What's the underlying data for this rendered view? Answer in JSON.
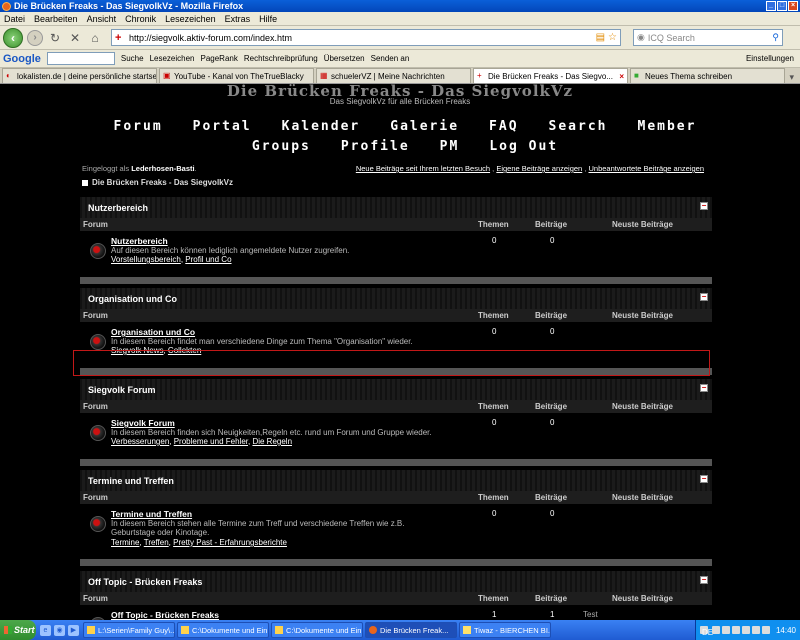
{
  "window": {
    "title": "Die Brücken Freaks - Das SiegvolkVz - Mozilla Firefox"
  },
  "menu": [
    "Datei",
    "Bearbeiten",
    "Ansicht",
    "Chronik",
    "Lesezeichen",
    "Extras",
    "Hilfe"
  ],
  "nav": {
    "url": "http://siegvolk.aktiv-forum.com/index.htm",
    "search_placeholder": "ICQ Search"
  },
  "google_toolbar": {
    "logo": "Google",
    "search_label": "Suche",
    "items": [
      "Lesezeichen",
      "PageRank",
      "Rechtschreibprüfung",
      "Übersetzen",
      "Senden an"
    ],
    "settings": "Einstellungen"
  },
  "tabs": [
    {
      "label": "lokalisten.de | deine persönliche startseite",
      "active": false
    },
    {
      "label": "YouTube - Kanal von TheTrueBlacky",
      "active": false
    },
    {
      "label": "schuelerVZ | Meine Nachrichten",
      "active": false
    },
    {
      "label": "Die Brücken Freaks - Das Siegvo...",
      "active": true
    },
    {
      "label": "Neues Thema schreiben",
      "active": false
    }
  ],
  "site": {
    "title": "Die Brücken Freaks - Das SiegvolkVz",
    "subtitle": "Das SiegvolkVz für alle Brücken Freaks"
  },
  "mainnav": {
    "row1": [
      "Forum",
      "Portal",
      "Kalender",
      "Galerie",
      "FAQ",
      "Search",
      "Member"
    ],
    "row2": [
      "Groups",
      "Profile",
      "PM",
      "Log Out"
    ]
  },
  "login": {
    "prefix": "Eingeloggt als",
    "user": "Lederhosen-Basti",
    "suffix": "."
  },
  "quicklinks": [
    "Neue Beiträge seit Ihrem letzten Besuch",
    "Eigene Beiträge anzeigen",
    "Unbeantwortete Beiträge anzeigen"
  ],
  "breadcrumb": "Die Brücken Freaks - Das SiegvolkVz",
  "columns": {
    "forum": "Forum",
    "themen": "Themen",
    "beitraege": "Beiträge",
    "neuste": "Neuste Beiträge"
  },
  "categories": [
    {
      "name": "Nutzerbereich",
      "forum_title": "Nutzerbereich",
      "desc": "Auf diesen Bereich können lediglich angemeldete Nutzer zugreifen.",
      "subforums": [
        "Vorstellungsbereich",
        "Profil und Co"
      ],
      "themen": "0",
      "beitraege": "0",
      "neuste": ""
    },
    {
      "name": "Organisation und Co",
      "forum_title": "Organisation und Co",
      "desc": "In diesem Bereich findet man verschiedene Dinge zum Thema \"Organisation\" wieder.",
      "subforums": [
        "Siegvolk News",
        "Collekten"
      ],
      "themen": "0",
      "beitraege": "0",
      "neuste": ""
    },
    {
      "name": "Siegvolk Forum",
      "forum_title": "Siegvolk Forum",
      "desc": "In diesem Bereich finden sich Neuigkeiten,Regeln etc. rund um Forum und Gruppe wieder.",
      "subforums": [
        "Verbesserungen",
        "Probleme und Fehler",
        "Die Regeln"
      ],
      "themen": "0",
      "beitraege": "0",
      "neuste": ""
    },
    {
      "name": "Termine und Treffen",
      "forum_title": "Termine und Treffen",
      "desc": "In diesem Bereich stehen alle Termine zum Treff und verschiedene Treffen wie z.B. Geburtstage oder Kinotage.",
      "subforums": [
        "Termine",
        "Treffen",
        "Pretty Past - Erfahrungsberichte"
      ],
      "themen": "0",
      "beitraege": "0",
      "neuste": ""
    },
    {
      "name": "Off Topic - Brücken Freaks",
      "forum_title": "Off Topic - Brücken Freaks",
      "desc": "",
      "subforums": [],
      "themen": "1",
      "beitraege": "1",
      "neuste": "Test"
    }
  ],
  "taskbar": {
    "start": "Start",
    "tasks": [
      {
        "label": "L:\\Serien\\Family Guy\\...",
        "active": false
      },
      {
        "label": "C:\\Dokumente und Ein...",
        "active": false
      },
      {
        "label": "C:\\Dokumente und Ein...",
        "active": false
      },
      {
        "label": "Die Brücken Freak...",
        "active": true
      },
      {
        "label": "Tiwaz - BIERCHEN BI...",
        "active": false
      }
    ],
    "lang": "DE",
    "clock": "14:40"
  }
}
